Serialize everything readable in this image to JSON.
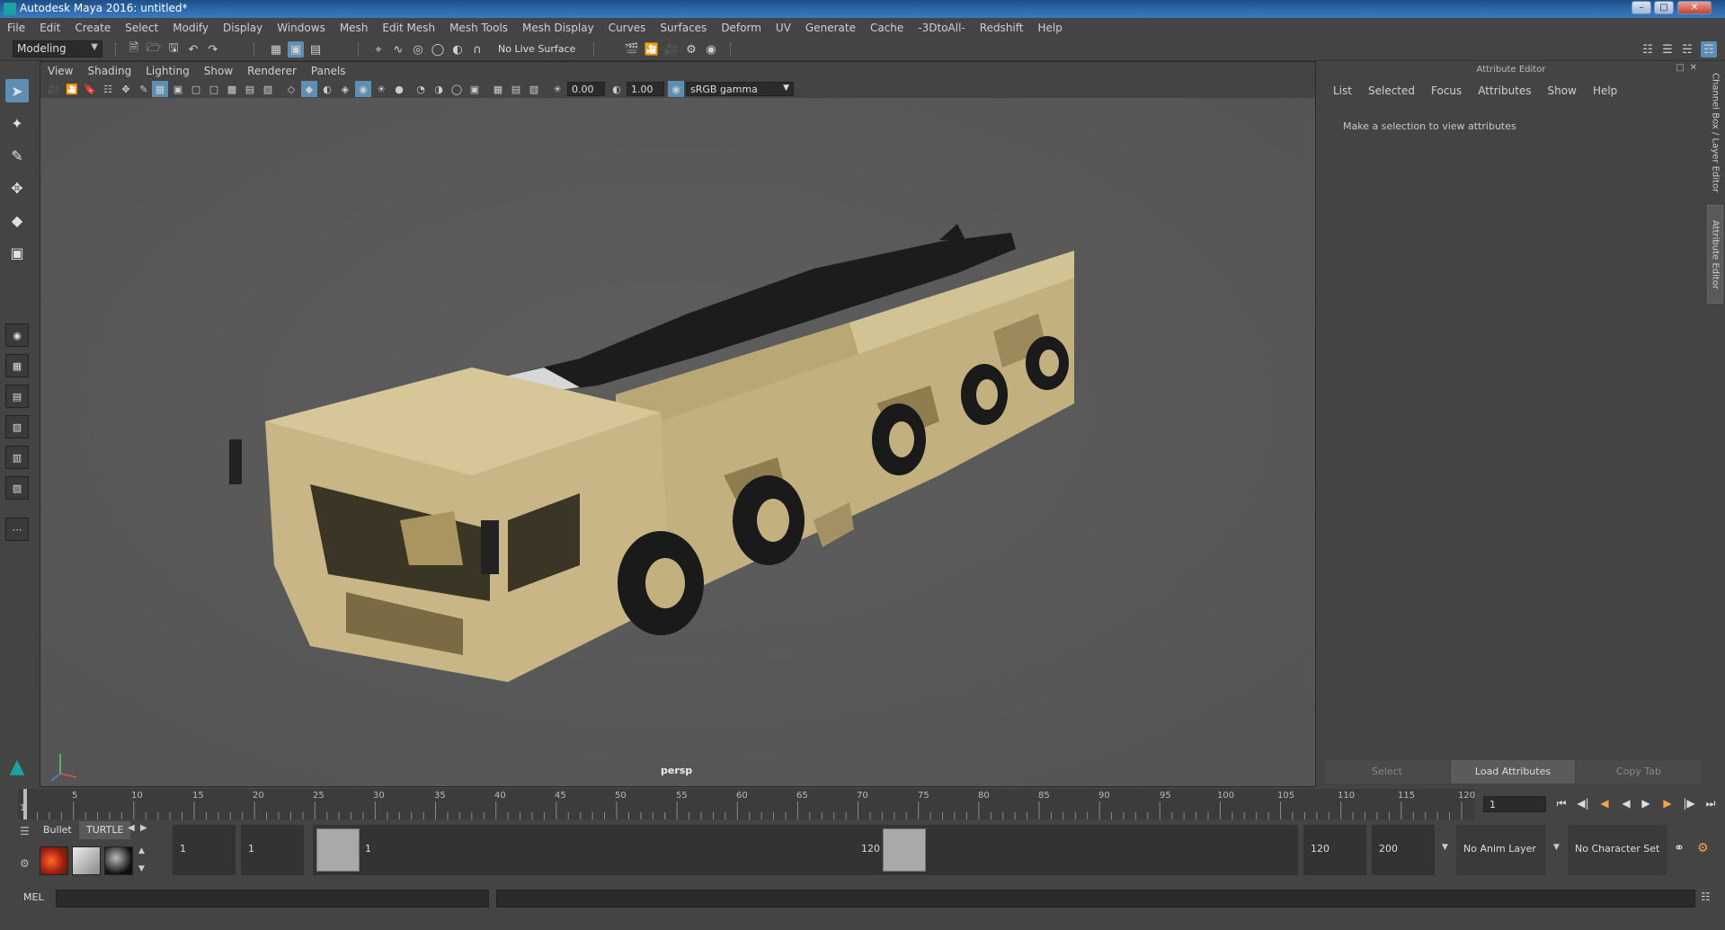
{
  "window": {
    "title": "Autodesk Maya 2016: untitled*"
  },
  "menubar": [
    "File",
    "Edit",
    "Create",
    "Select",
    "Modify",
    "Display",
    "Windows",
    "Mesh",
    "Edit Mesh",
    "Mesh Tools",
    "Mesh Display",
    "Curves",
    "Surfaces",
    "Deform",
    "UV",
    "Generate",
    "Cache",
    "-3DtoAll-",
    "Redshift",
    "Help"
  ],
  "statusline": {
    "mode": "Modeling",
    "live_surface": "No Live Surface"
  },
  "viewport": {
    "menu": [
      "View",
      "Shading",
      "Lighting",
      "Show",
      "Renderer",
      "Panels"
    ],
    "exposure": "0.00",
    "gamma": "1.00",
    "color_space": "sRGB gamma",
    "camera": "persp"
  },
  "attribute_editor": {
    "title": "Attribute Editor",
    "menu": [
      "List",
      "Selected",
      "Focus",
      "Attributes",
      "Show",
      "Help"
    ],
    "message": "Make a selection to view attributes",
    "buttons": {
      "select": "Select",
      "load": "Load Attributes",
      "copy": "Copy Tab"
    }
  },
  "side_tabs": {
    "channel_box": "Channel Box / Layer Editor",
    "attribute_editor": "Attribute Editor"
  },
  "timeslider": {
    "ticks": [
      "1",
      "5",
      "10",
      "15",
      "20",
      "25",
      "30",
      "35",
      "40",
      "45",
      "50",
      "55",
      "60",
      "65",
      "70",
      "75",
      "80",
      "85",
      "90",
      "95",
      "100",
      "105",
      "110",
      "115",
      "120"
    ],
    "current_frame": "1"
  },
  "shelf": {
    "tabs": [
      "Bullet",
      "TURTLE"
    ]
  },
  "range": {
    "start": "1",
    "playback_start": "1",
    "handle_start": "1",
    "handle_end": "120",
    "playback_end": "120",
    "end": "200",
    "anim_layer": "No Anim Layer",
    "character_set": "No Character Set"
  },
  "cmdline": {
    "label": "MEL"
  },
  "colors": {
    "accent": "#5d8fb5",
    "truck_tan": "#c8b686",
    "truck_shadow": "#8f7d50",
    "missile": "#1a1a1a",
    "nose_cone": "#d8d8d8"
  }
}
